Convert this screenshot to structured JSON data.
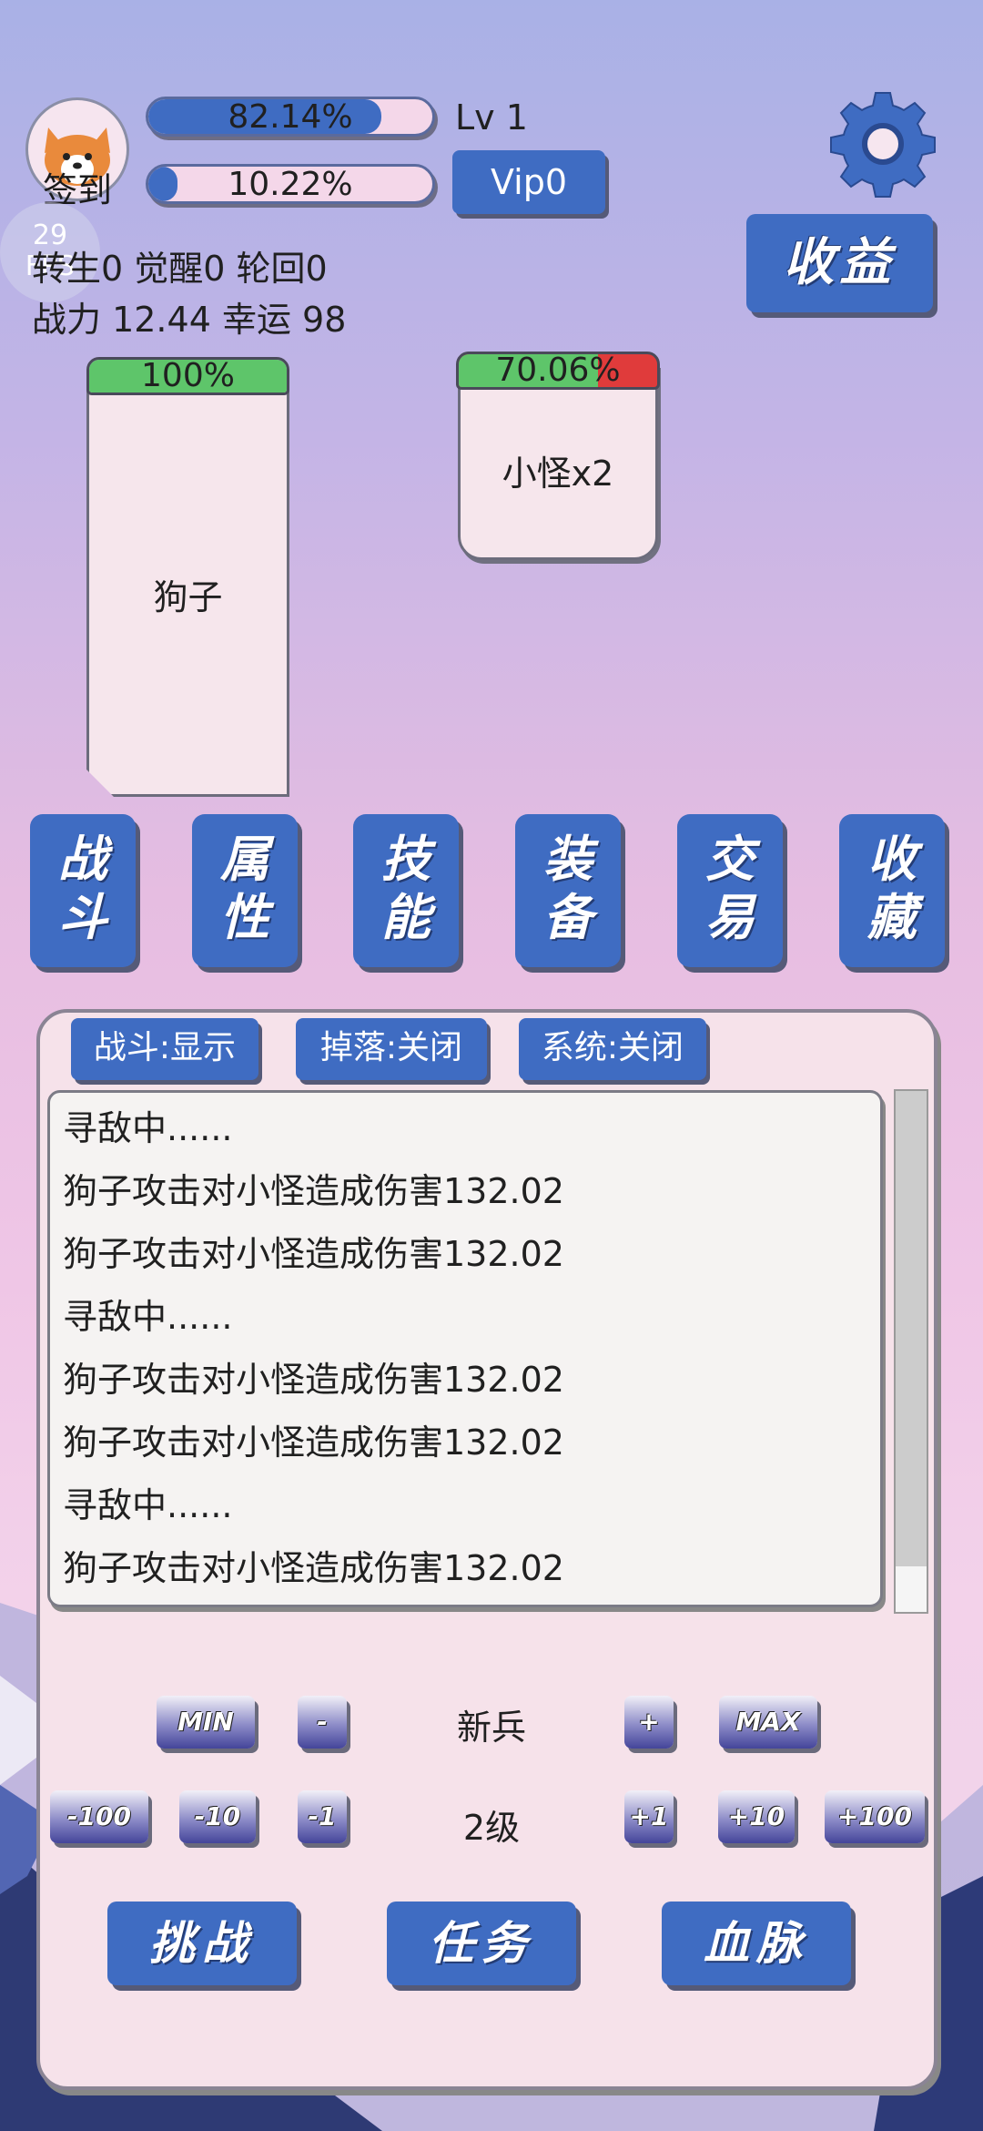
{
  "header": {
    "avatar_icon": "corgi-icon",
    "signin_label": "签到",
    "fps_value": "29",
    "fps_label": "FPS",
    "exp_bar": {
      "text": "82.14%",
      "percent": 82.14
    },
    "second_bar": {
      "text": "10.22%",
      "percent": 10.22
    },
    "level_label": "Lv 1",
    "vip_label": "Vip0",
    "stats_line1": "转生0 觉醒0 轮回0",
    "stats_line2": "战力 12.44  幸运 98",
    "settings_icon": "gear-icon",
    "income_label": "收益"
  },
  "battle": {
    "player": {
      "name": "狗子",
      "hp_text": "100%",
      "hp_percent": 100
    },
    "enemy": {
      "name": "小怪x2",
      "hp_text": "70.06%",
      "hp_percent": 70.06
    }
  },
  "tabs": [
    {
      "line1": "战",
      "line2": "斗"
    },
    {
      "line1": "属",
      "line2": "性"
    },
    {
      "line1": "技",
      "line2": "能"
    },
    {
      "line1": "装",
      "line2": "备"
    },
    {
      "line1": "交",
      "line2": "易"
    },
    {
      "line1": "收",
      "line2": "藏"
    }
  ],
  "log_panel": {
    "toggles": [
      "战斗:显示",
      "掉落:关闭",
      "系统:关闭"
    ],
    "lines": [
      "寻敌中......",
      "狗子攻击对小怪造成伤害132.02",
      "狗子攻击对小怪造成伤害132.02",
      "寻敌中......",
      "狗子攻击对小怪造成伤害132.02",
      "狗子攻击对小怪造成伤害132.02",
      "寻敌中......",
      "狗子攻击对小怪造成伤害132.02"
    ]
  },
  "controls": {
    "row1": {
      "min": "MIN",
      "minus": "-",
      "label": "新兵",
      "plus": "+",
      "max": "MAX"
    },
    "row2": {
      "m100": "-100",
      "m10": "-10",
      "m1": "-1",
      "label": "2级",
      "p1": "+1",
      "p10": "+10",
      "p100": "+100"
    },
    "challenge": "挑战",
    "tasks": "任务",
    "bloodline": "血脉"
  },
  "colors": {
    "accent": "#3f6cc2",
    "hp_green": "#5ec56a",
    "hp_red": "#e03b3b"
  }
}
